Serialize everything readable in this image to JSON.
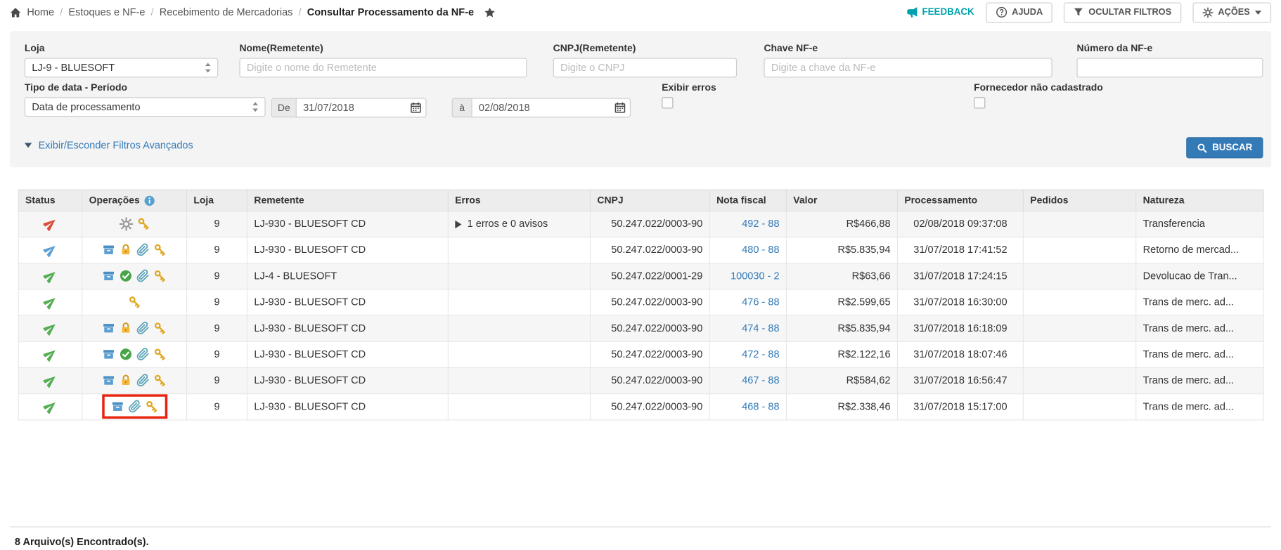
{
  "page": {
    "title": "Consultar Processamento da NF-e"
  },
  "breadcrumb": {
    "separator": "/",
    "items": [
      "Home",
      "Estoques e NF-e",
      "Recebimento de Mercadorias",
      "Consultar Processamento da NF-e"
    ]
  },
  "topbar": {
    "feedback_label": "FEEDBACK",
    "ajuda_label": "AJUDA",
    "ocultar_filtros_label": "OCULTAR FILTROS",
    "acoes_label": "AÇÕES"
  },
  "filters": {
    "loja": {
      "label": "Loja",
      "value": "LJ-9 - BLUESOFT"
    },
    "nome_remetente": {
      "label": "Nome(Remetente)",
      "placeholder": "Digite o nome do Remetente",
      "value": ""
    },
    "cnpj_remetente": {
      "label": "CNPJ(Remetente)",
      "placeholder": "Digite o CNPJ",
      "value": ""
    },
    "chave_nfe": {
      "label": "Chave NF-e",
      "placeholder": "Digite a chave da NF-e",
      "value": ""
    },
    "numero_nfe": {
      "label": "Número da NF-e",
      "value": ""
    },
    "tipo_data": {
      "label": "Tipo de data - Período",
      "value": "Data de processamento"
    },
    "periodo": {
      "de_label": "De",
      "de_value": "31/07/2018",
      "a_label": "à",
      "a_value": "02/08/2018"
    },
    "exibir_erros": {
      "label": "Exibir erros",
      "checked": false
    },
    "fornecedor_nao_cadastrado": {
      "label": "Fornecedor não cadastrado",
      "checked": false
    },
    "advanced_toggle_label": "Exibir/Esconder Filtros Avançados",
    "buscar_label": "BUSCAR"
  },
  "table": {
    "headers": [
      "Status",
      "Operações",
      "Loja",
      "Remetente",
      "Erros",
      "CNPJ",
      "Nota fiscal",
      "Valor",
      "Processamento",
      "Pedidos",
      "Natureza"
    ],
    "status_colors": {
      "red": "#dd4b39",
      "blue": "#5b9fd6",
      "green": "#54ae54"
    },
    "highlight_color": "#e8220c",
    "rows": [
      {
        "status": "red",
        "operations": [
          "gear",
          "key"
        ],
        "loja": "9",
        "remetente": "LJ-930 - BLUESOFT CD",
        "erros": "1 erros e 0 avisos",
        "cnpj": "50.247.022/0003-90",
        "nota_fiscal": "492 - 88",
        "valor": "R$466,88",
        "processamento": "02/08/2018 09:37:08",
        "pedidos": "",
        "natureza": "Transferencia",
        "ops_highlight": false
      },
      {
        "status": "blue",
        "operations": [
          "package",
          "lock",
          "paperclip",
          "key"
        ],
        "loja": "9",
        "remetente": "LJ-930 - BLUESOFT CD",
        "erros": "",
        "cnpj": "50.247.022/0003-90",
        "nota_fiscal": "480 - 88",
        "valor": "R$5.835,94",
        "processamento": "31/07/2018 17:41:52",
        "pedidos": "",
        "natureza": "Retorno de mercad...",
        "ops_highlight": false
      },
      {
        "status": "green",
        "operations": [
          "package",
          "check",
          "paperclip",
          "key"
        ],
        "loja": "9",
        "remetente": "LJ-4 - BLUESOFT",
        "erros": "",
        "cnpj": "50.247.022/0001-29",
        "nota_fiscal": "100030 - 2",
        "valor": "R$63,66",
        "processamento": "31/07/2018 17:24:15",
        "pedidos": "",
        "natureza": "Devolucao de Tran...",
        "ops_highlight": false
      },
      {
        "status": "green",
        "operations": [
          "key"
        ],
        "loja": "9",
        "remetente": "LJ-930 - BLUESOFT CD",
        "erros": "",
        "cnpj": "50.247.022/0003-90",
        "nota_fiscal": "476 - 88",
        "valor": "R$2.599,65",
        "processamento": "31/07/2018 16:30:00",
        "pedidos": "",
        "natureza": "Trans de merc. ad...",
        "ops_highlight": false
      },
      {
        "status": "green",
        "operations": [
          "package",
          "lock",
          "paperclip",
          "key"
        ],
        "loja": "9",
        "remetente": "LJ-930 - BLUESOFT CD",
        "erros": "",
        "cnpj": "50.247.022/0003-90",
        "nota_fiscal": "474 - 88",
        "valor": "R$5.835,94",
        "processamento": "31/07/2018 16:18:09",
        "pedidos": "",
        "natureza": "Trans de merc. ad...",
        "ops_highlight": false
      },
      {
        "status": "green",
        "operations": [
          "package",
          "check",
          "paperclip",
          "key"
        ],
        "loja": "9",
        "remetente": "LJ-930 - BLUESOFT CD",
        "erros": "",
        "cnpj": "50.247.022/0003-90",
        "nota_fiscal": "472 - 88",
        "valor": "R$2.122,16",
        "processamento": "31/07/2018 18:07:46",
        "pedidos": "",
        "natureza": "Trans de merc. ad...",
        "ops_highlight": false
      },
      {
        "status": "green",
        "operations": [
          "package",
          "lock",
          "paperclip",
          "key"
        ],
        "loja": "9",
        "remetente": "LJ-930 - BLUESOFT CD",
        "erros": "",
        "cnpj": "50.247.022/0003-90",
        "nota_fiscal": "467 - 88",
        "valor": "R$584,62",
        "processamento": "31/07/2018 16:56:47",
        "pedidos": "",
        "natureza": "Trans de merc. ad...",
        "ops_highlight": false
      },
      {
        "status": "green",
        "operations": [
          "package",
          "paperclip",
          "key"
        ],
        "loja": "9",
        "remetente": "LJ-930 - BLUESOFT CD",
        "erros": "",
        "cnpj": "50.247.022/0003-90",
        "nota_fiscal": "468 - 88",
        "valor": "R$2.338,46",
        "processamento": "31/07/2018 15:17:00",
        "pedidos": "",
        "natureza": "Trans de merc. ad...",
        "ops_highlight": true
      }
    ]
  },
  "footer": {
    "summary": "8 Arquivo(s) Encontrado(s)."
  },
  "icons": {
    "status": {
      "red": "red-paper-plane",
      "blue": "blue-paper-plane",
      "green": "green-paper-plane"
    },
    "operations": [
      "gear-icon",
      "key-icon",
      "package-icon",
      "lock-icon",
      "check-circle-icon",
      "paperclip-icon"
    ],
    "colors": {
      "accent_blue": "#337ab7",
      "teal": "#00a2ad",
      "key_gold": "#e0a620",
      "lock_orange": "#f3b73a"
    }
  }
}
